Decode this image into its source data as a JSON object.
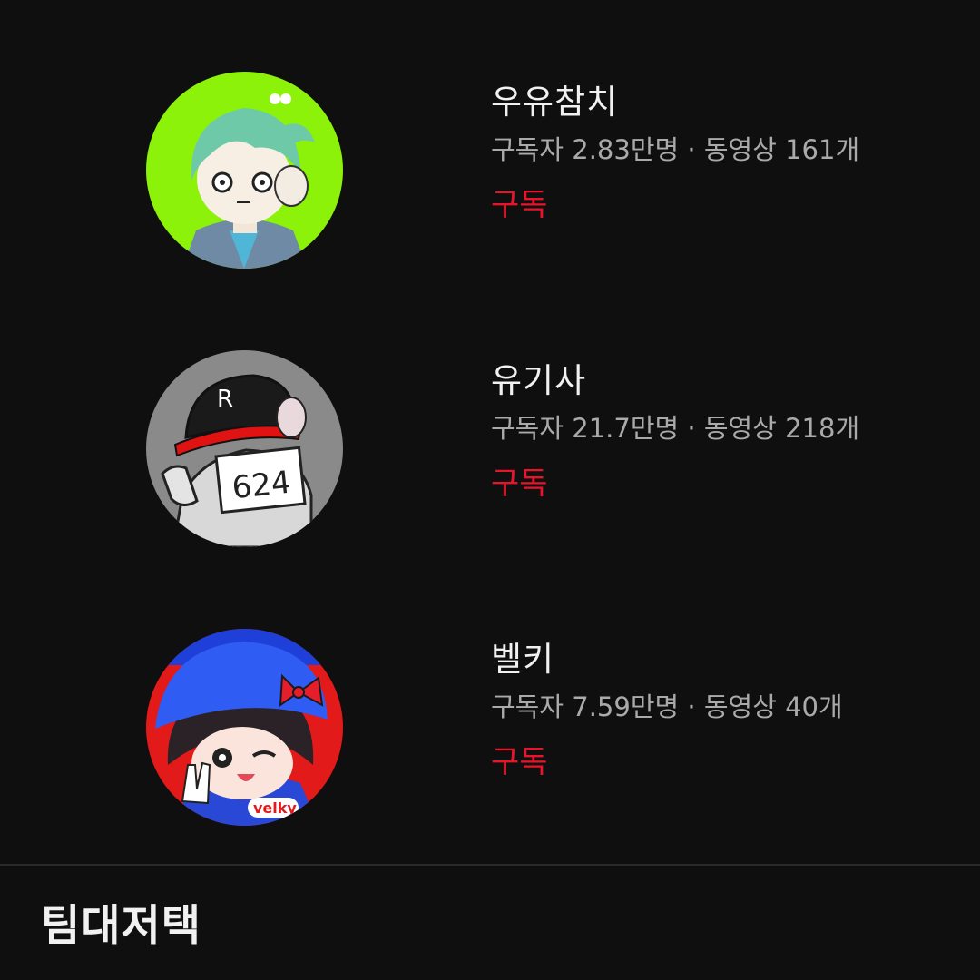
{
  "channels": [
    {
      "name": "우유참치",
      "meta": "구독자 2.83만명 · 동영상 161개",
      "subscribe_label": "구독",
      "avatar_bg": "#8df20a"
    },
    {
      "name": "유기사",
      "meta": "구독자 21.7만명 · 동영상 218개",
      "subscribe_label": "구독",
      "avatar_bg": "#8a8a8a",
      "avatar_text": "624"
    },
    {
      "name": "벨키",
      "meta": "구독자 7.59만명 · 동영상 40개",
      "subscribe_label": "구독",
      "avatar_bg": "#1e3fd8",
      "avatar_text": "velky"
    }
  ],
  "section": {
    "title": "팀대저택"
  },
  "colors": {
    "background": "#0f0f0f",
    "subscribe_accent": "#e8142a",
    "meta_text": "#aaaaaa"
  }
}
